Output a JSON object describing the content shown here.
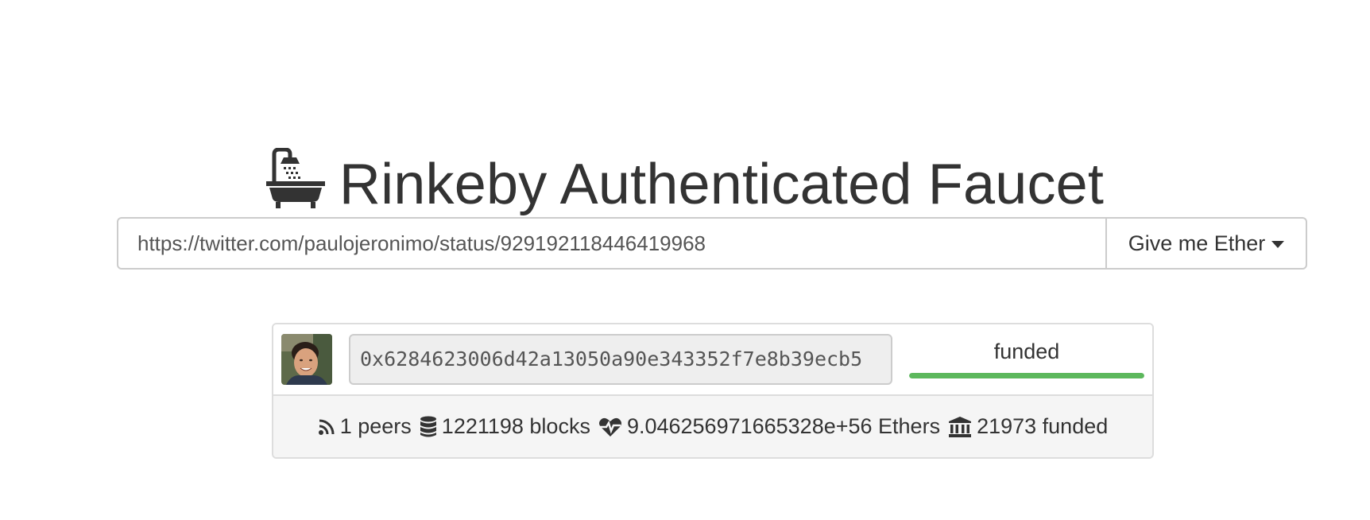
{
  "header": {
    "title": "Rinkeby Authenticated Faucet",
    "icon": "bath-shower-icon"
  },
  "request_form": {
    "url_value": "https://twitter.com/paulojeronimo/status/929192118446419968",
    "button_label": "Give me Ether"
  },
  "request": {
    "address": "0x6284623006d42a13050a90e343352f7e8b39ecb5",
    "status": "funded",
    "progress_fraction": 1.0
  },
  "stats": {
    "peers": "1 peers",
    "blocks": "1221198 blocks",
    "ethers": "9.046256971665328e+56 Ethers",
    "funded": "21973 funded"
  },
  "colors": {
    "text": "#333333",
    "progress": "#5cb85c",
    "footer_bg": "#f5f5f5",
    "border": "#cccccc"
  }
}
